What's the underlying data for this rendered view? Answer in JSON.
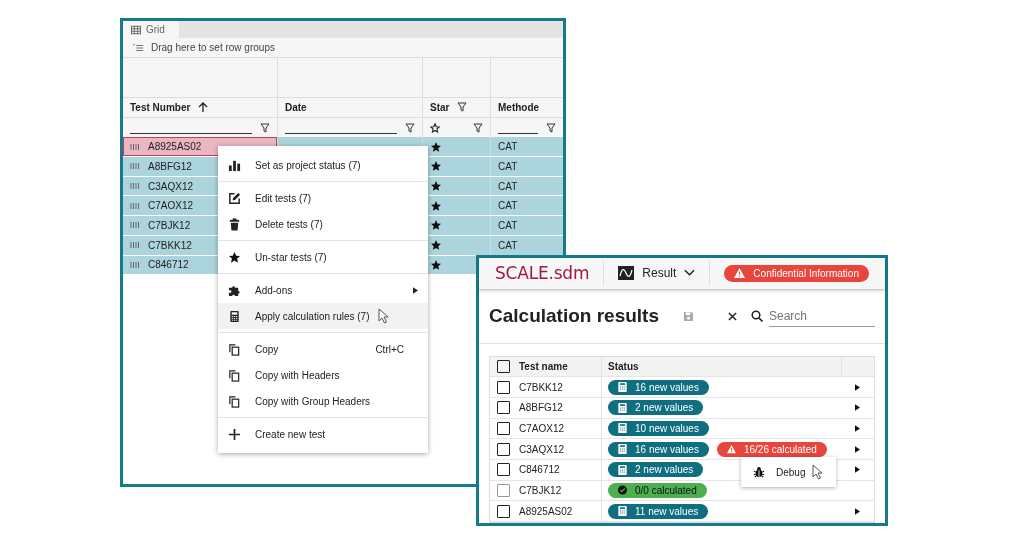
{
  "grid_window": {
    "tab": {
      "label": "Grid",
      "selected": true
    },
    "group_bar": "Drag here to set row groups",
    "columns": [
      {
        "label": "Test Number",
        "kind": "text",
        "sorted": true,
        "filtered": false
      },
      {
        "label": "Date",
        "kind": "text",
        "sorted": false,
        "filtered": false
      },
      {
        "label": "Star",
        "kind": "star",
        "sorted": false,
        "filtered": true
      },
      {
        "label": "Methode",
        "kind": "text",
        "sorted": false,
        "filtered": false
      }
    ],
    "rows": [
      {
        "test_number": "A8925AS02",
        "starred": true,
        "method": "CAT",
        "selected": true,
        "focused": true
      },
      {
        "test_number": "A8BFG12",
        "starred": true,
        "method": "CAT",
        "selected": true,
        "focused": false
      },
      {
        "test_number": "C3AQX12",
        "starred": true,
        "method": "CAT",
        "selected": true,
        "focused": false
      },
      {
        "test_number": "C7AOX12",
        "starred": true,
        "method": "CAT",
        "selected": true,
        "focused": false
      },
      {
        "test_number": "C7BJK12",
        "starred": true,
        "method": "CAT",
        "selected": true,
        "focused": false
      },
      {
        "test_number": "C7BKK12",
        "starred": true,
        "method": "CAT",
        "selected": true,
        "focused": false
      },
      {
        "test_number": "C846712",
        "starred": true,
        "method": "",
        "selected": true,
        "focused": false
      }
    ],
    "context_menu": [
      [
        {
          "kind": "chart",
          "label": "Set as project status (7)",
          "hovered": false
        }
      ],
      [
        {
          "kind": "edit",
          "label": "Edit tests (7)",
          "hovered": false
        },
        {
          "kind": "trash",
          "label": "Delete tests (7)",
          "hovered": false
        }
      ],
      [
        {
          "kind": "star",
          "label": "Un-star tests (7)",
          "hovered": false
        }
      ],
      [
        {
          "kind": "puzzle",
          "label": "Add-ons",
          "submenu": true,
          "hovered": false
        },
        {
          "kind": "calculator",
          "label": "Apply calculation rules (7)",
          "hovered": true
        }
      ],
      [
        {
          "kind": "copy",
          "label": "Copy",
          "shortcut": "Ctrl+C",
          "hovered": false
        },
        {
          "kind": "copy",
          "label": "Copy with Headers",
          "hovered": false
        },
        {
          "kind": "copy",
          "label": "Copy with Group Headers",
          "hovered": false
        }
      ],
      [
        {
          "kind": "plus",
          "label": "Create new test",
          "hovered": false
        }
      ]
    ]
  },
  "results_window": {
    "logo": "SCALE.sdm",
    "menu": "Result",
    "banner": "Confidential Information",
    "title": "Calculation results",
    "search": {
      "placeholder": "Search"
    },
    "columns": [
      "Test name",
      "Status"
    ],
    "select_all_checked": false,
    "rows": [
      {
        "name": "C7BKK12",
        "checked": false,
        "disabled": false,
        "expandable": true,
        "statuses": [
          {
            "kind": "new",
            "text": "16 new values"
          }
        ]
      },
      {
        "name": "A8BFG12",
        "checked": false,
        "disabled": false,
        "expandable": true,
        "statuses": [
          {
            "kind": "new",
            "text": "2 new values"
          }
        ]
      },
      {
        "name": "C7AOX12",
        "checked": false,
        "disabled": false,
        "expandable": true,
        "statuses": [
          {
            "kind": "new",
            "text": "10 new values"
          }
        ]
      },
      {
        "name": "C3AQX12",
        "checked": false,
        "disabled": false,
        "expandable": true,
        "statuses": [
          {
            "kind": "new",
            "text": "16 new values"
          },
          {
            "kind": "error",
            "text": "16/26 calculated"
          }
        ]
      },
      {
        "name": "C846712",
        "checked": false,
        "disabled": false,
        "expandable": true,
        "statuses": [
          {
            "kind": "new",
            "text": "2 new values"
          }
        ]
      },
      {
        "name": "C7BJK12",
        "checked": false,
        "disabled": true,
        "expandable": false,
        "statuses": [
          {
            "kind": "done",
            "text": "0/0 calculated"
          }
        ]
      },
      {
        "name": "A8925AS02",
        "checked": false,
        "disabled": false,
        "expandable": true,
        "statuses": [
          {
            "kind": "new",
            "text": "11 new values"
          }
        ]
      }
    ],
    "popup": {
      "label": "Debug"
    }
  }
}
